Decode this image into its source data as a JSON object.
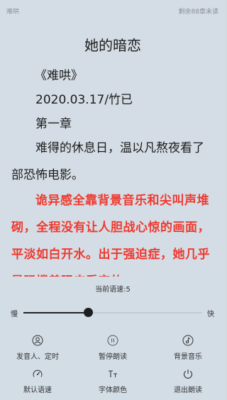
{
  "status_bar": {
    "book_title": "难哄",
    "progress_text": "剩余88章未读"
  },
  "reader": {
    "chapter_title": "她的暗恋",
    "lines": [
      "《难哄》",
      "2020.03.17/竹已",
      "第一章",
      "难得的休息日，温以凡熬夜看了",
      "部恐怖电影。"
    ],
    "highlighted_lines": [
      "诡异感全靠背景音乐和尖叫声堆",
      "砌，全程没有让人胆战心惊的画面，",
      "平淡如白开水。出于强迫症，她几乎",
      "是强撑着眼皮看完的"
    ],
    "highlight_color": "#ee3a30"
  },
  "tts_panel": {
    "speed_label": "当前语速:5",
    "speed_min_label": "慢",
    "speed_max_label": "快",
    "speed_value_fraction": 0.36,
    "controls": {
      "voice": {
        "label": "发音人、定时",
        "icon": "person-icon"
      },
      "pause": {
        "label": "暂停朗读",
        "icon": "pause-icon"
      },
      "music": {
        "label": "背景音乐",
        "icon": "music-note-icon"
      },
      "default_speed": {
        "label": "默认语速",
        "icon": "gauge-icon"
      },
      "font_color": {
        "label": "字体颜色",
        "icon": "text-size-icon"
      },
      "exit": {
        "label": "退出朗读",
        "icon": "power-icon"
      }
    }
  }
}
